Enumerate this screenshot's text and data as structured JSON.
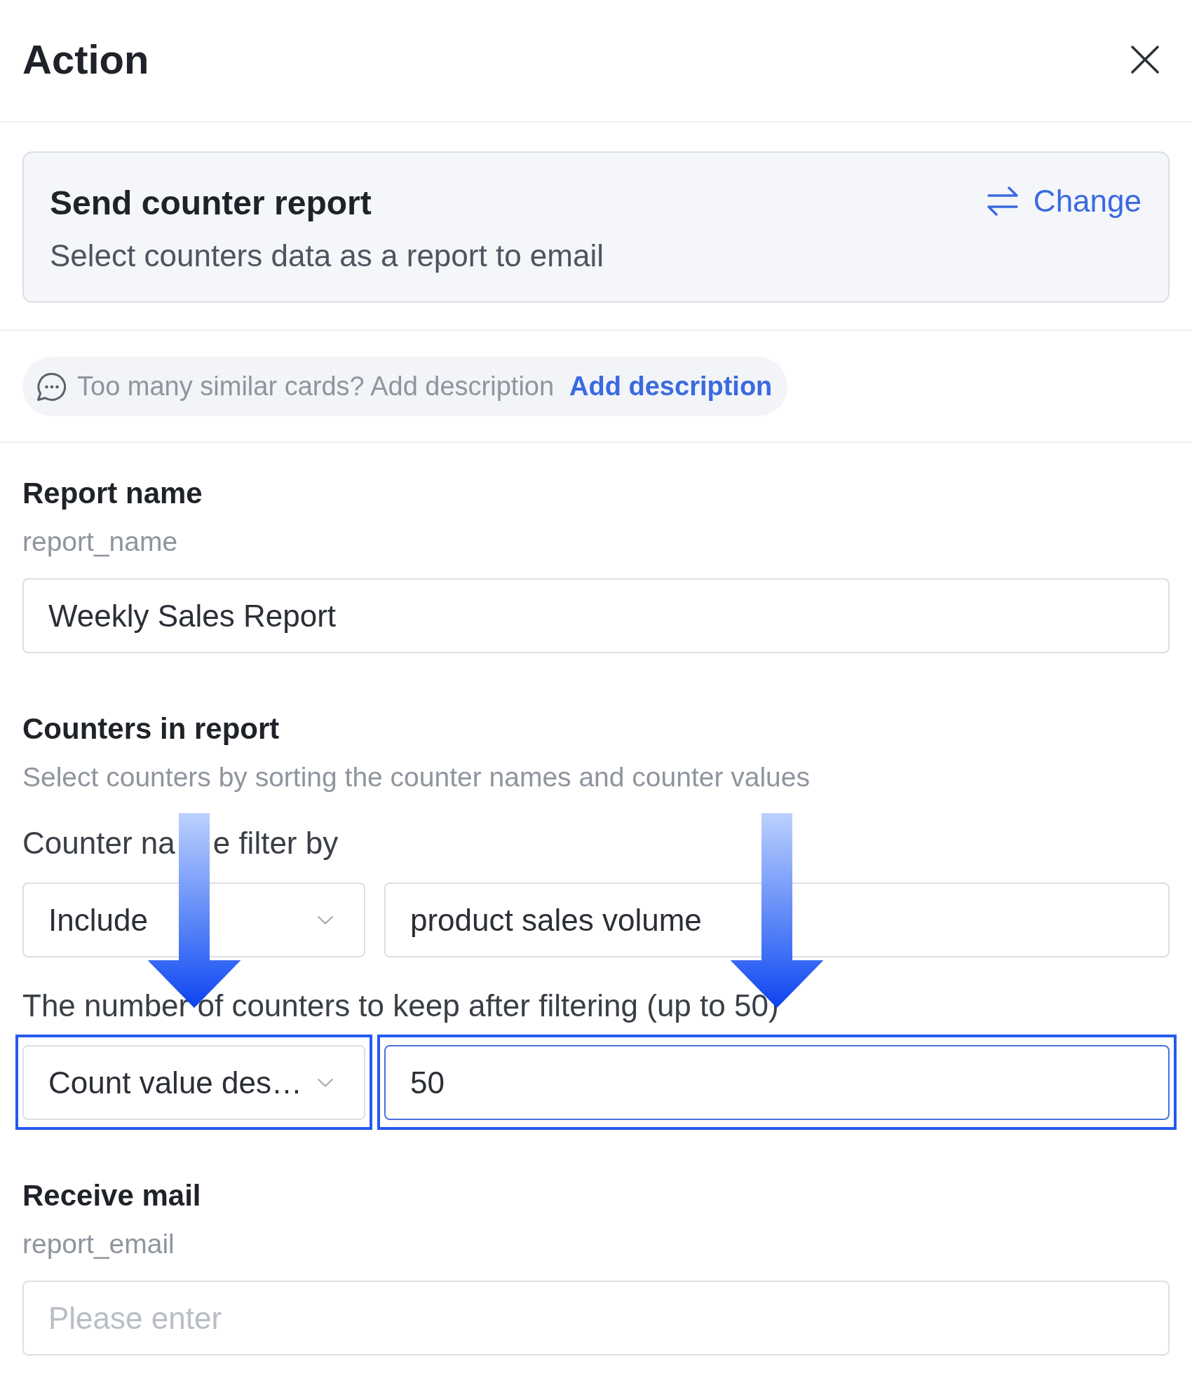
{
  "header": {
    "title": "Action"
  },
  "action_card": {
    "title": "Send counter report",
    "description": "Select counters data as a report to email",
    "change_link": "Change"
  },
  "description_hint": {
    "text": "Too many similar cards? Add description",
    "link": "Add description"
  },
  "fields": [
    {
      "kind": "input",
      "label": "Report name",
      "key": "report_name",
      "value": "Weekly Sales Report"
    },
    {
      "kind": "group",
      "label": "Counters in report",
      "hint": "Select counters by sorting the counter names and counter values",
      "rows": [
        {
          "label": [
            "Counter na",
            "e filter by"
          ],
          "select": {
            "value": "Include",
            "highlighted": false
          },
          "input": {
            "value": "product sales volume",
            "highlighted": false,
            "focused": false
          }
        },
        {
          "label": [
            "The number of counters to keep after filtering (up to 50)"
          ],
          "select": {
            "value": "Count value des…",
            "highlighted": true
          },
          "input": {
            "value": "50",
            "highlighted": true,
            "focused": true
          }
        }
      ]
    },
    {
      "kind": "input",
      "label": "Receive mail",
      "key": "report_email",
      "placeholder": "Please enter"
    }
  ]
}
